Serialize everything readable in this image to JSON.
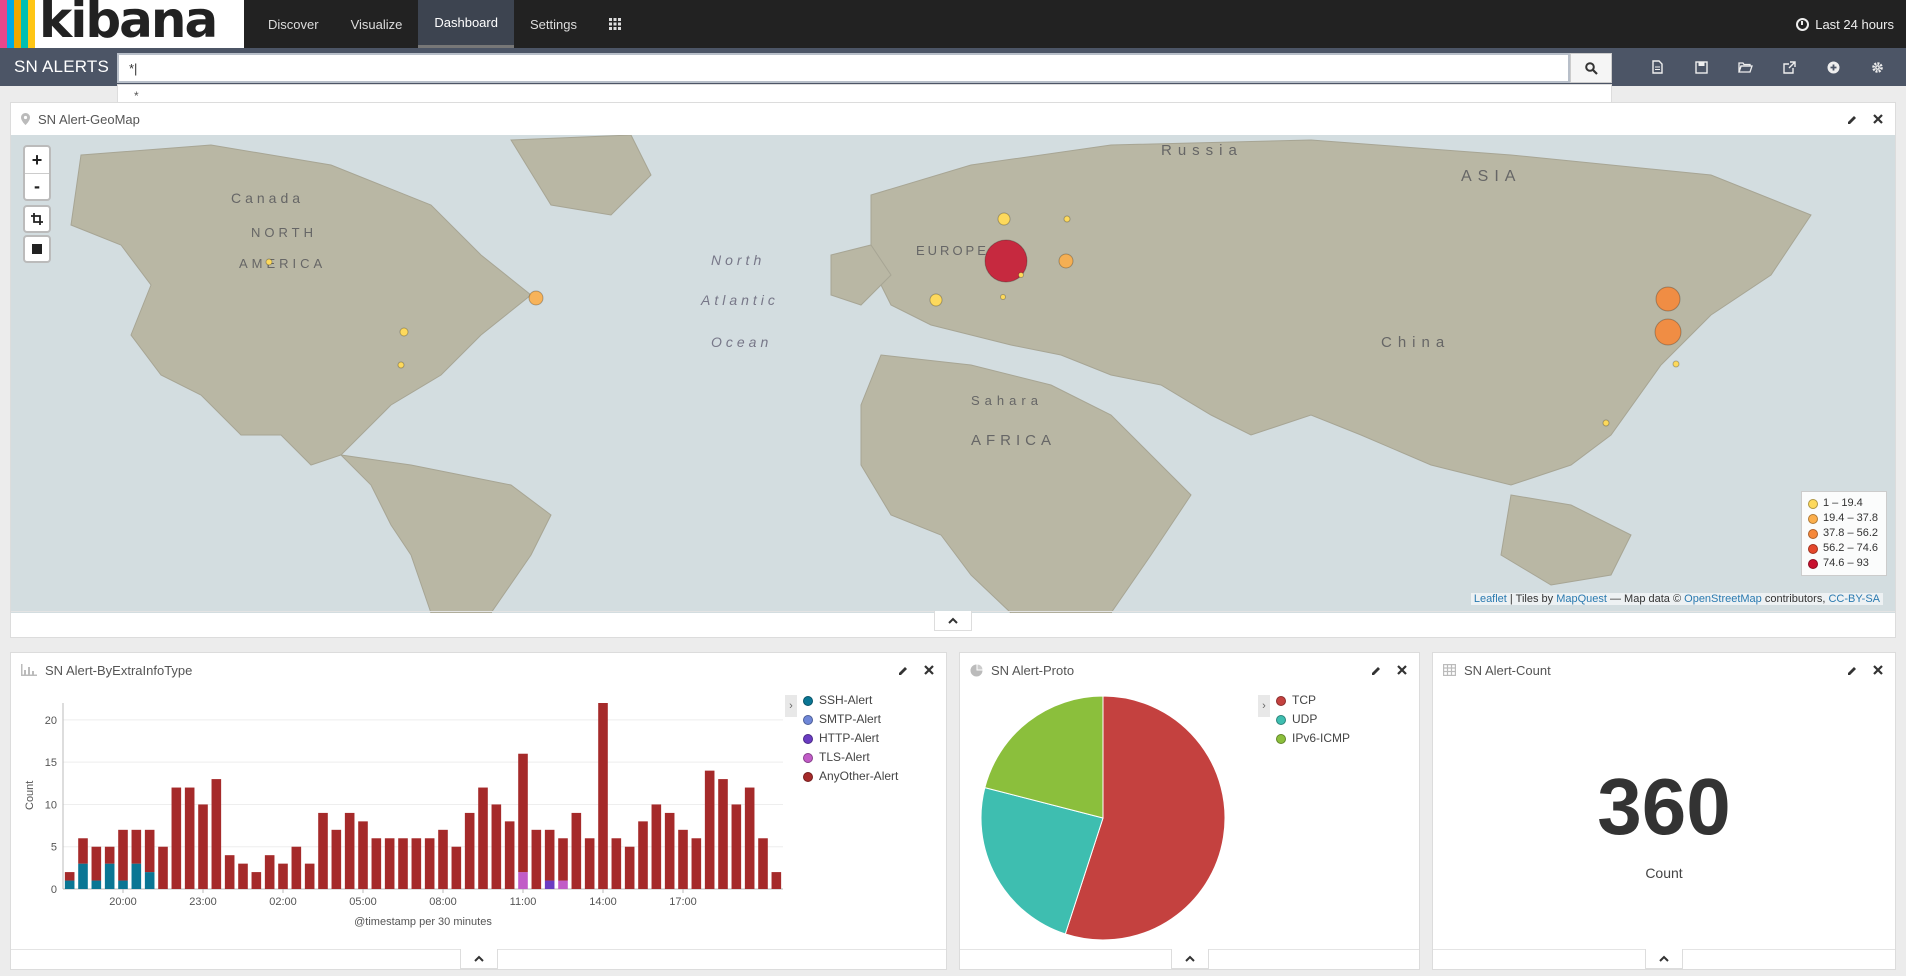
{
  "app": {
    "logo_text": "kibana",
    "logo_colors": [
      "#e8478b",
      "#00a9e5",
      "#f0a800",
      "#00bfb3",
      "#3ebeb0",
      "#fec514"
    ]
  },
  "nav": {
    "items": [
      "Discover",
      "Visualize",
      "Dashboard",
      "Settings"
    ],
    "active": "Dashboard",
    "time_label": "Last 24 hours"
  },
  "dashboard": {
    "title": "SN ALERTS",
    "query": "*|",
    "suggestion": "*"
  },
  "geomap": {
    "title": "SN Alert-GeoMap",
    "legend": [
      {
        "label": "1 – 19.4",
        "color": "#fdd95c"
      },
      {
        "label": "19.4 – 37.8",
        "color": "#fbae4b"
      },
      {
        "label": "37.8 – 56.2",
        "color": "#f6883a"
      },
      {
        "label": "56.2 – 74.6",
        "color": "#e4472b"
      },
      {
        "label": "74.6 – 93",
        "color": "#c8102e"
      }
    ],
    "attribution": {
      "leaflet": "Leaflet",
      "tiles_by": " | Tiles by ",
      "mapquest": "MapQuest",
      "map_data": " — Map data © ",
      "osm": "OpenStreetMap",
      "contributors": " contributors, ",
      "license": "CC-BY-SA"
    },
    "labels": [
      "NORTH",
      "AMERICA",
      "EUROPE",
      "ASIA",
      "AFRICA",
      "Russia",
      "China",
      "North",
      "Atlantic",
      "Ocean",
      "Sahara",
      "Canada"
    ]
  },
  "byextra": {
    "title": "SN Alert-ByExtraInfoType",
    "ylabel": "Count",
    "xlabel": "@timestamp per 30 minutes",
    "y_ticks": [
      0,
      5,
      10,
      15,
      20
    ],
    "x_ticks": [
      "20:00",
      "23:00",
      "02:00",
      "05:00",
      "08:00",
      "11:00",
      "14:00",
      "17:00"
    ],
    "legend": [
      {
        "name": "SSH-Alert",
        "color": "#0a7694"
      },
      {
        "name": "SMTP-Alert",
        "color": "#6f87d8"
      },
      {
        "name": "HTTP-Alert",
        "color": "#6a3cc2"
      },
      {
        "name": "TLS-Alert",
        "color": "#c15cc7"
      },
      {
        "name": "AnyOther-Alert",
        "color": "#a52a2a"
      }
    ]
  },
  "chart_data": [
    {
      "type": "bar",
      "title": "SN Alert-ByExtraInfoType",
      "xlabel": "@timestamp per 30 minutes",
      "ylabel": "Count",
      "ylim": [
        0,
        22
      ],
      "x_tick_labels": [
        "20:00",
        "23:00",
        "02:00",
        "05:00",
        "08:00",
        "11:00",
        "14:00",
        "17:00"
      ],
      "stacked": true,
      "series": [
        {
          "name": "SSH-Alert",
          "values": [
            1,
            3,
            1,
            3,
            1,
            3,
            2,
            0,
            0,
            0,
            0,
            0,
            0,
            0,
            0,
            0,
            0,
            0,
            0,
            0,
            0,
            0,
            0,
            0,
            0,
            0,
            0,
            0,
            0,
            0,
            0,
            0,
            0,
            0,
            0,
            0,
            0,
            0,
            0,
            0,
            0,
            0,
            0,
            0,
            0,
            0,
            0,
            0,
            0,
            0,
            0,
            0,
            0,
            0
          ]
        },
        {
          "name": "HTTP-Alert",
          "values": [
            0,
            0,
            0,
            0,
            0,
            0,
            0,
            0,
            0,
            0,
            0,
            0,
            0,
            0,
            0,
            0,
            0,
            0,
            0,
            0,
            0,
            0,
            0,
            0,
            0,
            0,
            0,
            0,
            0,
            0,
            0,
            0,
            0,
            0,
            0,
            0,
            1,
            0,
            0,
            0,
            0,
            0,
            0,
            0,
            0,
            0,
            0,
            0,
            0,
            0,
            0,
            0,
            0,
            0
          ]
        },
        {
          "name": "TLS-Alert",
          "values": [
            0,
            0,
            0,
            0,
            0,
            0,
            0,
            0,
            0,
            0,
            0,
            0,
            0,
            0,
            0,
            0,
            0,
            0,
            0,
            0,
            0,
            0,
            0,
            0,
            0,
            0,
            0,
            0,
            0,
            0,
            0,
            0,
            0,
            0,
            2,
            0,
            0,
            1,
            0,
            0,
            0,
            0,
            0,
            0,
            0,
            0,
            0,
            0,
            0,
            0,
            0,
            0,
            0,
            0
          ]
        },
        {
          "name": "AnyOther-Alert",
          "values": [
            1,
            3,
            4,
            2,
            6,
            4,
            5,
            5,
            12,
            12,
            10,
            13,
            4,
            3,
            2,
            4,
            3,
            5,
            3,
            9,
            7,
            9,
            8,
            6,
            6,
            6,
            6,
            6,
            7,
            5,
            9,
            12,
            10,
            8,
            14,
            7,
            6,
            5,
            9,
            6,
            22,
            6,
            5,
            8,
            10,
            9,
            7,
            6,
            14,
            13,
            10,
            12,
            6,
            2
          ]
        }
      ]
    },
    {
      "type": "pie",
      "title": "SN Alert-Proto",
      "categories": [
        "TCP",
        "UDP",
        "IPv6-ICMP"
      ],
      "values": [
        55,
        24,
        21
      ],
      "colors": [
        "#c4413f",
        "#3ebeb0",
        "#8bbf3c"
      ]
    }
  ],
  "proto": {
    "title": "SN Alert-Proto",
    "legend": [
      {
        "name": "TCP",
        "color": "#c4413f"
      },
      {
        "name": "UDP",
        "color": "#3ebeb0"
      },
      {
        "name": "IPv6-ICMP",
        "color": "#8bbf3c"
      }
    ]
  },
  "count": {
    "title": "SN Alert-Count",
    "value": "360",
    "label": "Count"
  }
}
